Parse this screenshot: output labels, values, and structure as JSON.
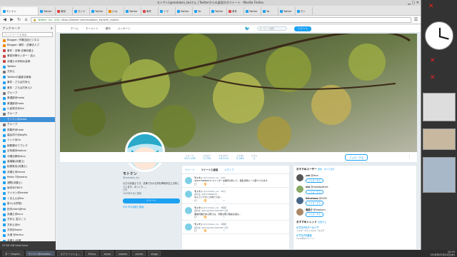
{
  "window": {
    "title": "モトケン(@motoken_tw)さん | Twitterからの返信付きツイート - Mozilla Firefox"
  },
  "tabs": [
    {
      "label": "モトケン",
      "color": "#1da1f2"
    },
    {
      "label": "Twitter",
      "color": "#1da1f2"
    },
    {
      "label": "事前",
      "color": "#e04545"
    },
    {
      "label": "モトケ",
      "color": "#1da1f2"
    },
    {
      "label": "Twitter",
      "color": "#1da1f2"
    },
    {
      "label": "(14)",
      "color": "#f08a00"
    },
    {
      "label": "Twitter",
      "color": "#1da1f2"
    },
    {
      "label": "事件",
      "color": "#e04545"
    },
    {
      "label": "イマ",
      "color": "#1da1f2"
    },
    {
      "label": "Twitter",
      "color": "#1da1f2"
    },
    {
      "label": "Tw",
      "color": "#1da1f2"
    },
    {
      "label": "Twitter",
      "color": "#1da1f2"
    },
    {
      "label": "事件",
      "color": "#e04545"
    },
    {
      "label": "Twitter",
      "color": "#1da1f2"
    },
    {
      "label": "Tw",
      "color": "#1da1f2"
    },
    {
      "label": "Twitter",
      "color": "#1da1f2"
    },
    {
      "label": "モト",
      "color": "#1da1f2"
    }
  ],
  "url": {
    "org": "Twitter, Inc. (US)",
    "path": "https://twitter.com/motoken_tw/with_replies"
  },
  "sidebar": {
    "title": "ブックマーク",
    "search": "ブックマークを検索",
    "items": [
      {
        "label": "Blogger: 市場法廷ビジネス",
        "color": "#f08a00"
      },
      {
        "label": "Blogger: 事件・法律法人ブ",
        "color": "#f08a00"
      },
      {
        "label": "事件・法律 法律弁護士",
        "color": "#cc4444"
      },
      {
        "label": "事前対策センター・加入",
        "color": "#cc4444"
      },
      {
        "label": "弁護士の判例大会時",
        "color": "#cc4444"
      },
      {
        "label": "Twitter",
        "color": "#1da1f2"
      },
      {
        "label": "方針え",
        "color": "#777"
      },
      {
        "label": "Twitterの高度な検索",
        "color": "#1da1f2"
      },
      {
        "label": "事件・さらば方針え",
        "color": "#1da1f2"
      },
      {
        "label": "事件・さらば方針え2",
        "color": "#1da1f2"
      },
      {
        "label": "グループ",
        "color": "#777"
      },
      {
        "label": "美濃部@hokai",
        "color": "#1da1f2"
      },
      {
        "label": "美濃部@hoka",
        "color": "#1da1f2"
      },
      {
        "label": "小倉秀夫@hid",
        "color": "#1da1f2"
      },
      {
        "label": "グループ",
        "color": "#777"
      },
      {
        "label": "モトケン@moto",
        "color": "#1da1f2",
        "selected": true
      },
      {
        "label": "グループ",
        "color": "#777"
      },
      {
        "label": "弥勒丹@hoke",
        "color": "#1da1f2"
      },
      {
        "label": "高谷洋介@bigPo",
        "color": "#1da1f2"
      },
      {
        "label": "ミンナ@rin",
        "color": "#1da1f2"
      },
      {
        "label": "総務課のワプレク",
        "color": "#1da1f2"
      },
      {
        "label": "空気感@atohon",
        "color": "#1da1f2"
      },
      {
        "label": "今寝法師@oino",
        "color": "#1da1f2"
      },
      {
        "label": "高橋葉(弁護士)",
        "color": "#1da1f2"
      },
      {
        "label": "松原真也(弁護士)",
        "color": "#1da1f2"
      },
      {
        "label": "弁護士@kenzo",
        "color": "#1da1f2"
      },
      {
        "label": "Reiko T@aneha",
        "color": "#1da1f2"
      },
      {
        "label": "浦野(弁護士)",
        "color": "#1da1f2"
      },
      {
        "label": "坂本@ON2O",
        "color": "#1da1f2"
      },
      {
        "label": "ライオン@haroie",
        "color": "#1da1f2"
      },
      {
        "label": "くまえん@kur",
        "color": "#1da1f2"
      },
      {
        "label": "新人(大学院)",
        "color": "#1da1f2"
      },
      {
        "label": "田中(kishi@ma",
        "color": "#1da1f2"
      },
      {
        "label": "弁護士@to-iz",
        "color": "#1da1f2"
      },
      {
        "label": "方針え 並びこう",
        "color": "#1da1f2"
      },
      {
        "label": "方針え@kt",
        "color": "#1da1f2"
      },
      {
        "label": "方向@kanor",
        "color": "#1da1f2"
      },
      {
        "label": "大須 @fortno",
        "color": "#1da1f2"
      },
      {
        "label": "弁護士(弁護",
        "color": "#1da1f2"
      },
      {
        "label": "池田(sagih",
        "color": "#1da1f2"
      },
      {
        "label": "梶田(Natim",
        "color": "#1da1f2"
      },
      {
        "label": "三輪@tam",
        "color": "#1da1f2"
      },
      {
        "label": "雨 方向rov",
        "color": "#1da1f2"
      }
    ]
  },
  "twitter": {
    "nav": {
      "home": "ホーム",
      "moments": "モーメント",
      "notifications": "通知",
      "messages": "メッセージ",
      "search": "キーワード検索",
      "tweet": "ツイート"
    },
    "stats": [
      {
        "label": "ツイート",
        "value": "107,136"
      },
      {
        "label": "フォロー",
        "value": "3,730"
      },
      {
        "label": "フォロワー",
        "value": "19,115"
      },
      {
        "label": "いいね",
        "value": "5,283"
      },
      {
        "label": "リスト",
        "value": "2"
      }
    ],
    "follow_label": "フォローする",
    "profile": {
      "name": "モトケン",
      "handle": "@motoken_tw",
      "bio": "ただの弁護士です。法律で分かる事を興味本位に分析しています。ゆっくり…。",
      "location": "日本",
      "joined": "2009年5月に登録",
      "tweet_to": "ツイート",
      "media": "595 件の画像と動画"
    },
    "timeline_tabs": [
      "ツイート",
      "ツイートと返信",
      "メディア"
    ],
    "tweets": [
      {
        "name": "モトケン",
        "handle": "@motoken_tw · 54分",
        "text": "@ItoFYRRBQI7A マインダーは相手の判って、混乱状態に一人部つてかます",
        "reply": "",
        "retweet": ""
      },
      {
        "name": "モトケン",
        "handle": "@motoken_tw · 56分",
        "text": "なんていうかこのあたりは...",
        "reply": "返信先: @ItoFYRRBQI7A",
        "retweet": ""
      },
      {
        "name": "モトケン",
        "handle": "@motoken_tw · 1時間",
        "text": "事前対策がある限りは、可能な限り確実な話も...",
        "reply": "返信先: @8ringzQOzuSOhWE7 ほか",
        "retweet": ""
      },
      {
        "name": "モトケン",
        "handle": "@motoken_tw · 1時間",
        "text": "",
        "reply": "返信先: @8ringzQOzuSOhWE7 ほか",
        "retweet": ""
      }
    ],
    "suggestions": {
      "title": "おすすめユーザー",
      "refresh": "更新 · すべて表示",
      "users": [
        {
          "name": "yok",
          "handle": "@tenn",
          "follow": "フォローする",
          "color": "#555"
        },
        {
          "name": "nisi",
          "handle": "@motokodirect",
          "follow": "フォローする",
          "color": "#8a6"
        },
        {
          "name": "hikurasoo",
          "handle": "@SOIR",
          "follow": "フォローする",
          "color": "#468"
        },
        {
          "name": "鳥居@",
          "handle": "@hisakazu",
          "follow": "フォローする",
          "color": "#a86"
        }
      ]
    },
    "trends": {
      "title": "おすすめトレンド",
      "change": "変更する",
      "items": [
        {
          "tag": "#ブログのアーカイブ",
          "desc": "フォローするフォロワーなどが"
        },
        {
          "tag": "#ブログの設定",
          "desc": "5,112件のツイート"
        }
      ]
    }
  },
  "statusbar": "3T DS GiB Hard Drive",
  "taskbar": {
    "items": [
      "ター Dolphin",
      "モトケン@motoke...",
      "スクリーンショ...",
      "XTicks",
      "xeyes",
      "kalarm",
      "xclock",
      "xlogo"
    ],
    "active_index": 1,
    "time": "20:53",
    "date": "2018年05月24日(木)"
  }
}
